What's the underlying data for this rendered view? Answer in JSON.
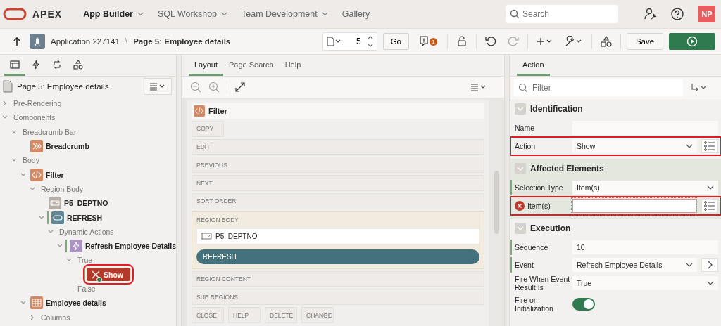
{
  "header": {
    "logo": "APEX",
    "nav": [
      {
        "label": "App Builder",
        "selected": true,
        "dropdown": true
      },
      {
        "label": "SQL Workshop",
        "selected": false,
        "dropdown": true
      },
      {
        "label": "Team Development",
        "selected": false,
        "dropdown": true
      },
      {
        "label": "Gallery",
        "selected": false,
        "dropdown": false
      }
    ],
    "search": {
      "placeholder": "Search"
    },
    "avatar": "NP"
  },
  "toolbar": {
    "application": "Application 227141",
    "separator": "\\",
    "page": "Page 5: Employee details",
    "page_number": "5",
    "go": "Go",
    "warnings": "1",
    "save": "Save"
  },
  "left": {
    "tabs": [
      {
        "kind": "tree",
        "selected": true
      },
      {
        "kind": "bolt",
        "selected": false
      },
      {
        "kind": "cycle",
        "selected": false
      },
      {
        "kind": "shapes",
        "selected": false
      }
    ],
    "heading": "Page 5: Employee details",
    "tree": [
      {
        "label": "Pre-Rendering",
        "kind": "folder",
        "expanded": false,
        "selected": false
      },
      {
        "label": "Components",
        "kind": "folder",
        "expanded": true,
        "selected": false,
        "children": [
          {
            "label": "Breadcrumb Bar",
            "kind": "folder",
            "expanded": true,
            "selected": false,
            "children": [
              {
                "label": "Breadcrumb",
                "kind": "breadcrumb",
                "selected": false
              }
            ]
          },
          {
            "label": "Body",
            "kind": "folder",
            "expanded": true,
            "selected": false,
            "children": [
              {
                "label": "Filter",
                "kind": "region",
                "expanded": true,
                "selected": false,
                "children": [
                  {
                    "label": "Region Body",
                    "kind": "folder",
                    "expanded": true,
                    "selected": false,
                    "children": [
                      {
                        "label": "P5_DEPTNO",
                        "kind": "item",
                        "selected": false
                      },
                      {
                        "label": "REFRESH",
                        "kind": "button",
                        "expanded": true,
                        "modified": true,
                        "selected": false,
                        "children": [
                          {
                            "label": "Dynamic Actions",
                            "kind": "folder",
                            "expanded": true,
                            "selected": false,
                            "children": [
                              {
                                "label": "Refresh Employee Details",
                                "kind": "event",
                                "expanded": true,
                                "modified": true,
                                "selected": false,
                                "children": [
                                  {
                                    "label": "True",
                                    "kind": "folder",
                                    "expanded": true,
                                    "selected": false,
                                    "children": [
                                      {
                                        "label": "Show",
                                        "kind": "action",
                                        "modified": true,
                                        "highlighted": true,
                                        "selected": true
                                      }
                                    ]
                                  },
                                  {
                                    "label": "False",
                                    "kind": "folder",
                                    "selected": false
                                  }
                                ]
                              }
                            ]
                          }
                        ]
                      }
                    ]
                  }
                ]
              },
              {
                "label": "Employee details",
                "kind": "report",
                "expanded": true,
                "selected": false,
                "children": [
                  {
                    "label": "Columns",
                    "kind": "folder",
                    "expanded": false,
                    "selected": false
                  }
                ]
              }
            ]
          }
        ]
      }
    ]
  },
  "middle": {
    "tabs": [
      {
        "label": "Layout",
        "selected": true
      },
      {
        "label": "Page Search",
        "selected": false
      },
      {
        "label": "Help",
        "selected": false
      }
    ],
    "region": "Filter",
    "rows": [
      {
        "kind": "chips",
        "labels": [
          "COPY"
        ]
      },
      {
        "kind": "slot",
        "label": "EDIT"
      },
      {
        "kind": "slot",
        "label": "PREVIOUS"
      },
      {
        "kind": "slot",
        "label": "NEXT"
      },
      {
        "kind": "slot",
        "label": "SORT ORDER"
      },
      {
        "kind": "body",
        "label": "REGION BODY",
        "item": "P5_DEPTNO",
        "button": "REFRESH"
      },
      {
        "kind": "slot",
        "label": "REGION CONTENT"
      },
      {
        "kind": "slot",
        "label": "SUB REGIONS"
      },
      {
        "kind": "chips",
        "labels": [
          "CLOSE",
          "HELP",
          "DELETE",
          "CHANGE"
        ]
      }
    ]
  },
  "right": {
    "tabs": [
      {
        "label": "Action",
        "selected": true
      }
    ],
    "filter": {
      "placeholder": "Filter"
    },
    "groups": [
      {
        "title": "Identification",
        "tinted": false,
        "fields": [
          {
            "label": "Name",
            "kind": "text",
            "modified": false,
            "error": false,
            "highlighted": false
          },
          {
            "label": "Action",
            "kind": "select-list",
            "value": "Show",
            "modified": false,
            "error": false,
            "highlighted": true
          }
        ]
      },
      {
        "title": "Affected Elements",
        "tinted": true,
        "fields": [
          {
            "label": "Selection Type",
            "kind": "select",
            "value": "Item(s)",
            "modified": true,
            "error": false,
            "highlighted": false
          },
          {
            "label": "Item(s)",
            "kind": "text-list",
            "modified": false,
            "error": true,
            "highlighted": true
          }
        ]
      },
      {
        "title": "Execution",
        "tinted": false,
        "fields": [
          {
            "label": "Sequence",
            "kind": "text",
            "value": "10",
            "modified": true,
            "error": false,
            "highlighted": false
          },
          {
            "label": "Event",
            "kind": "select-link",
            "value": "Refresh Employee Details",
            "modified": true,
            "error": false,
            "highlighted": false
          },
          {
            "label": "Fire When Event Result Is",
            "kind": "select",
            "value": "True",
            "modified": false,
            "error": false,
            "highlighted": false
          },
          {
            "label": "Fire on Initialization",
            "kind": "switch",
            "on": true,
            "modified": false,
            "error": false,
            "highlighted": false
          }
        ]
      }
    ]
  }
}
